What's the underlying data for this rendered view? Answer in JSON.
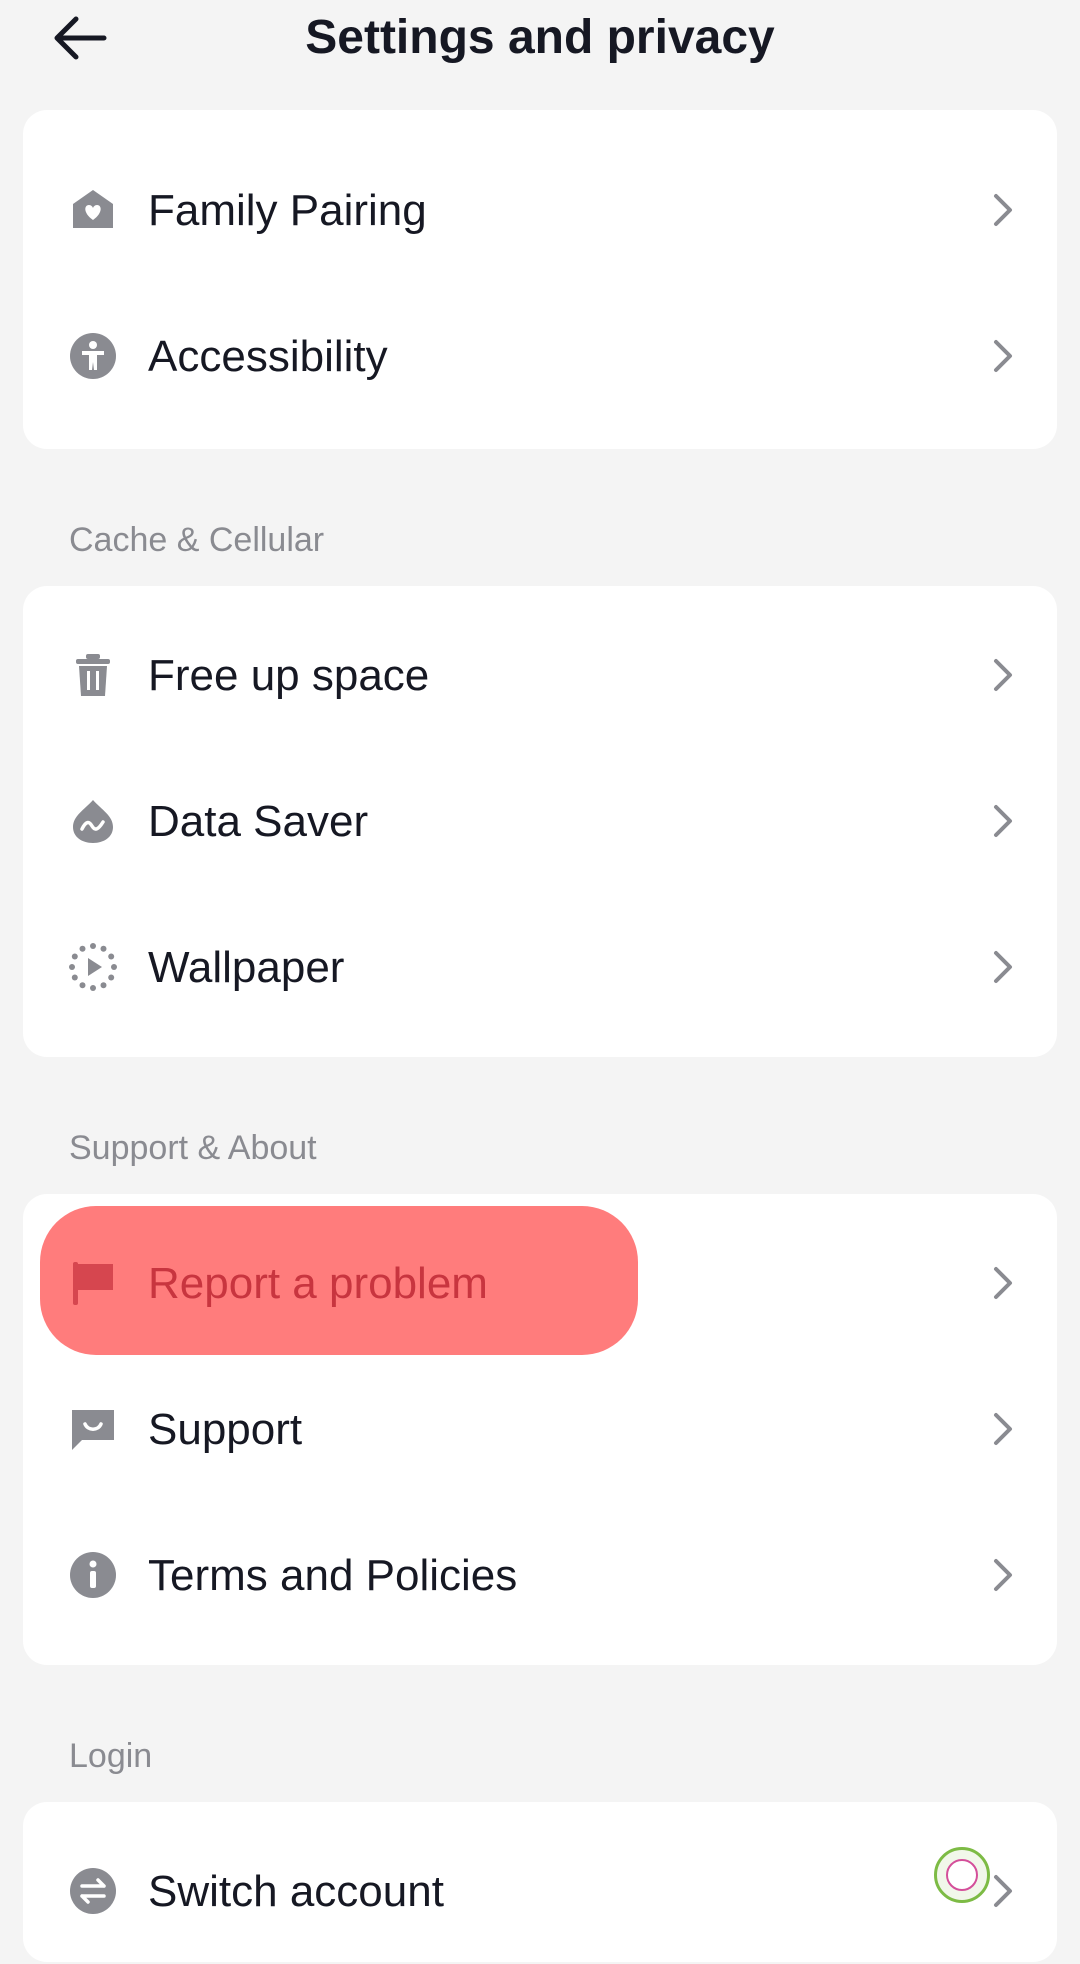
{
  "header": {
    "title": "Settings and privacy"
  },
  "cards": {
    "general": [
      {
        "label": "Family Pairing",
        "icon": "family-pairing-icon"
      },
      {
        "label": "Accessibility",
        "icon": "accessibility-icon"
      }
    ],
    "cache": [
      {
        "label": "Free up space",
        "icon": "trash-icon"
      },
      {
        "label": "Data Saver",
        "icon": "data-saver-icon"
      },
      {
        "label": "Wallpaper",
        "icon": "wallpaper-icon"
      }
    ],
    "support": [
      {
        "label": "Report a problem",
        "icon": "flag-icon",
        "highlighted": true
      },
      {
        "label": "Support",
        "icon": "support-chat-icon"
      },
      {
        "label": "Terms and Policies",
        "icon": "info-icon"
      }
    ],
    "login": [
      {
        "label": "Switch account",
        "icon": "switch-account-icon"
      }
    ]
  },
  "sections": {
    "cache_title": "Cache & Cellular",
    "support_title": "Support & About",
    "login_title": "Login"
  },
  "colors": {
    "background": "#f4f4f4",
    "card": "#ffffff",
    "text": "#161823",
    "secondary_text": "#8a8b91",
    "icon": "#8a8b91",
    "highlight": "#ff5050",
    "highlight_text": "#c8353f"
  }
}
